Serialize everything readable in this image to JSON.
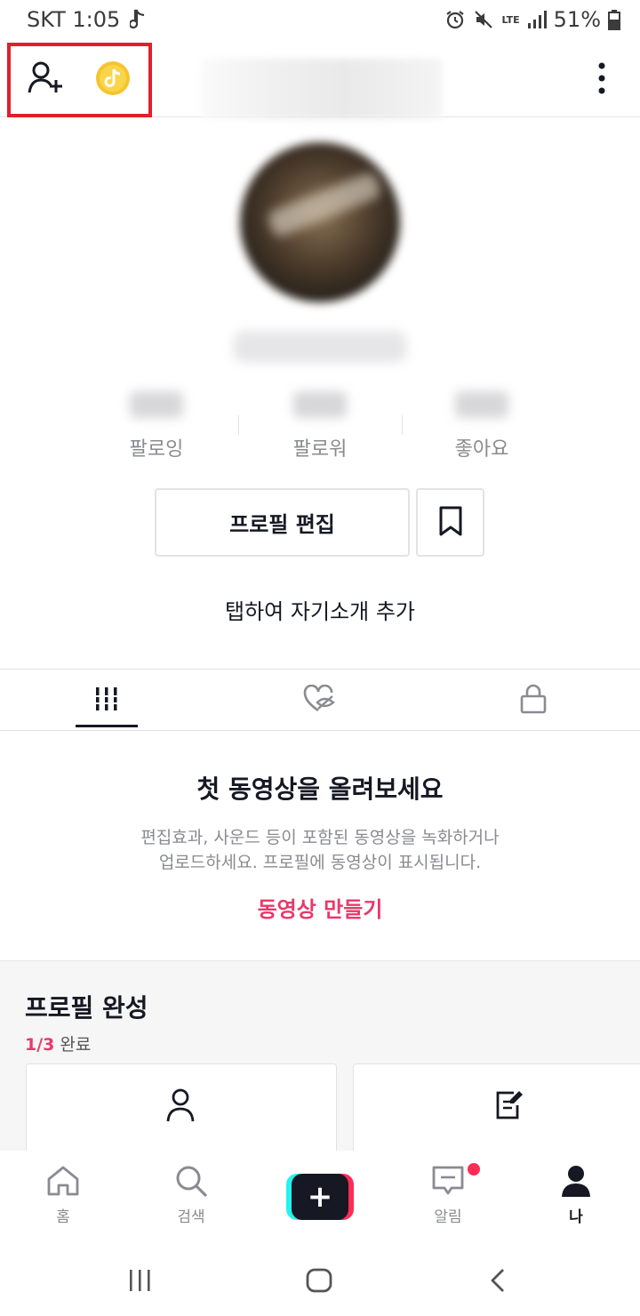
{
  "status_bar": {
    "carrier_time": "SKT 1:05",
    "battery": "51%",
    "network": "LTE"
  },
  "header": {
    "username": "",
    "icons": [
      "add-friend-icon",
      "tiktok-coin-icon",
      "more-options-icon"
    ]
  },
  "profile": {
    "stats": [
      {
        "label": "팔로잉"
      },
      {
        "label": "팔로워"
      },
      {
        "label": "좋아요"
      }
    ],
    "edit_button": "프로필 편집",
    "bio_prompt": "탭하여 자기소개 추가"
  },
  "tabs": [
    {
      "icon": "videos-grid-icon",
      "active": true
    },
    {
      "icon": "liked-hidden-icon",
      "active": false
    },
    {
      "icon": "lock-icon",
      "active": false
    }
  ],
  "empty_state": {
    "title": "첫 동영상을 올려보세요",
    "description_line1": "편집효과, 사운드 등이 포함된 동영상을 녹화하거나",
    "description_line2": "업로드하세요. 프로필에 동영상이 표시됩니다.",
    "cta": "동영상 만들기"
  },
  "completion": {
    "title": "프로필 완성",
    "progress_fraction": "1/3",
    "progress_suffix": " 완료"
  },
  "bottom_nav": {
    "items": [
      {
        "label": "홈",
        "icon": "home-icon"
      },
      {
        "label": "검색",
        "icon": "search-icon"
      },
      {
        "label": "",
        "icon": "create-plus-icon"
      },
      {
        "label": "알림",
        "icon": "inbox-icon"
      },
      {
        "label": "나",
        "icon": "profile-icon"
      }
    ]
  },
  "colors": {
    "accent": "#e8396a",
    "highlight": "#e0202b",
    "text_primary": "#161823",
    "text_secondary": "#8a8b91"
  }
}
